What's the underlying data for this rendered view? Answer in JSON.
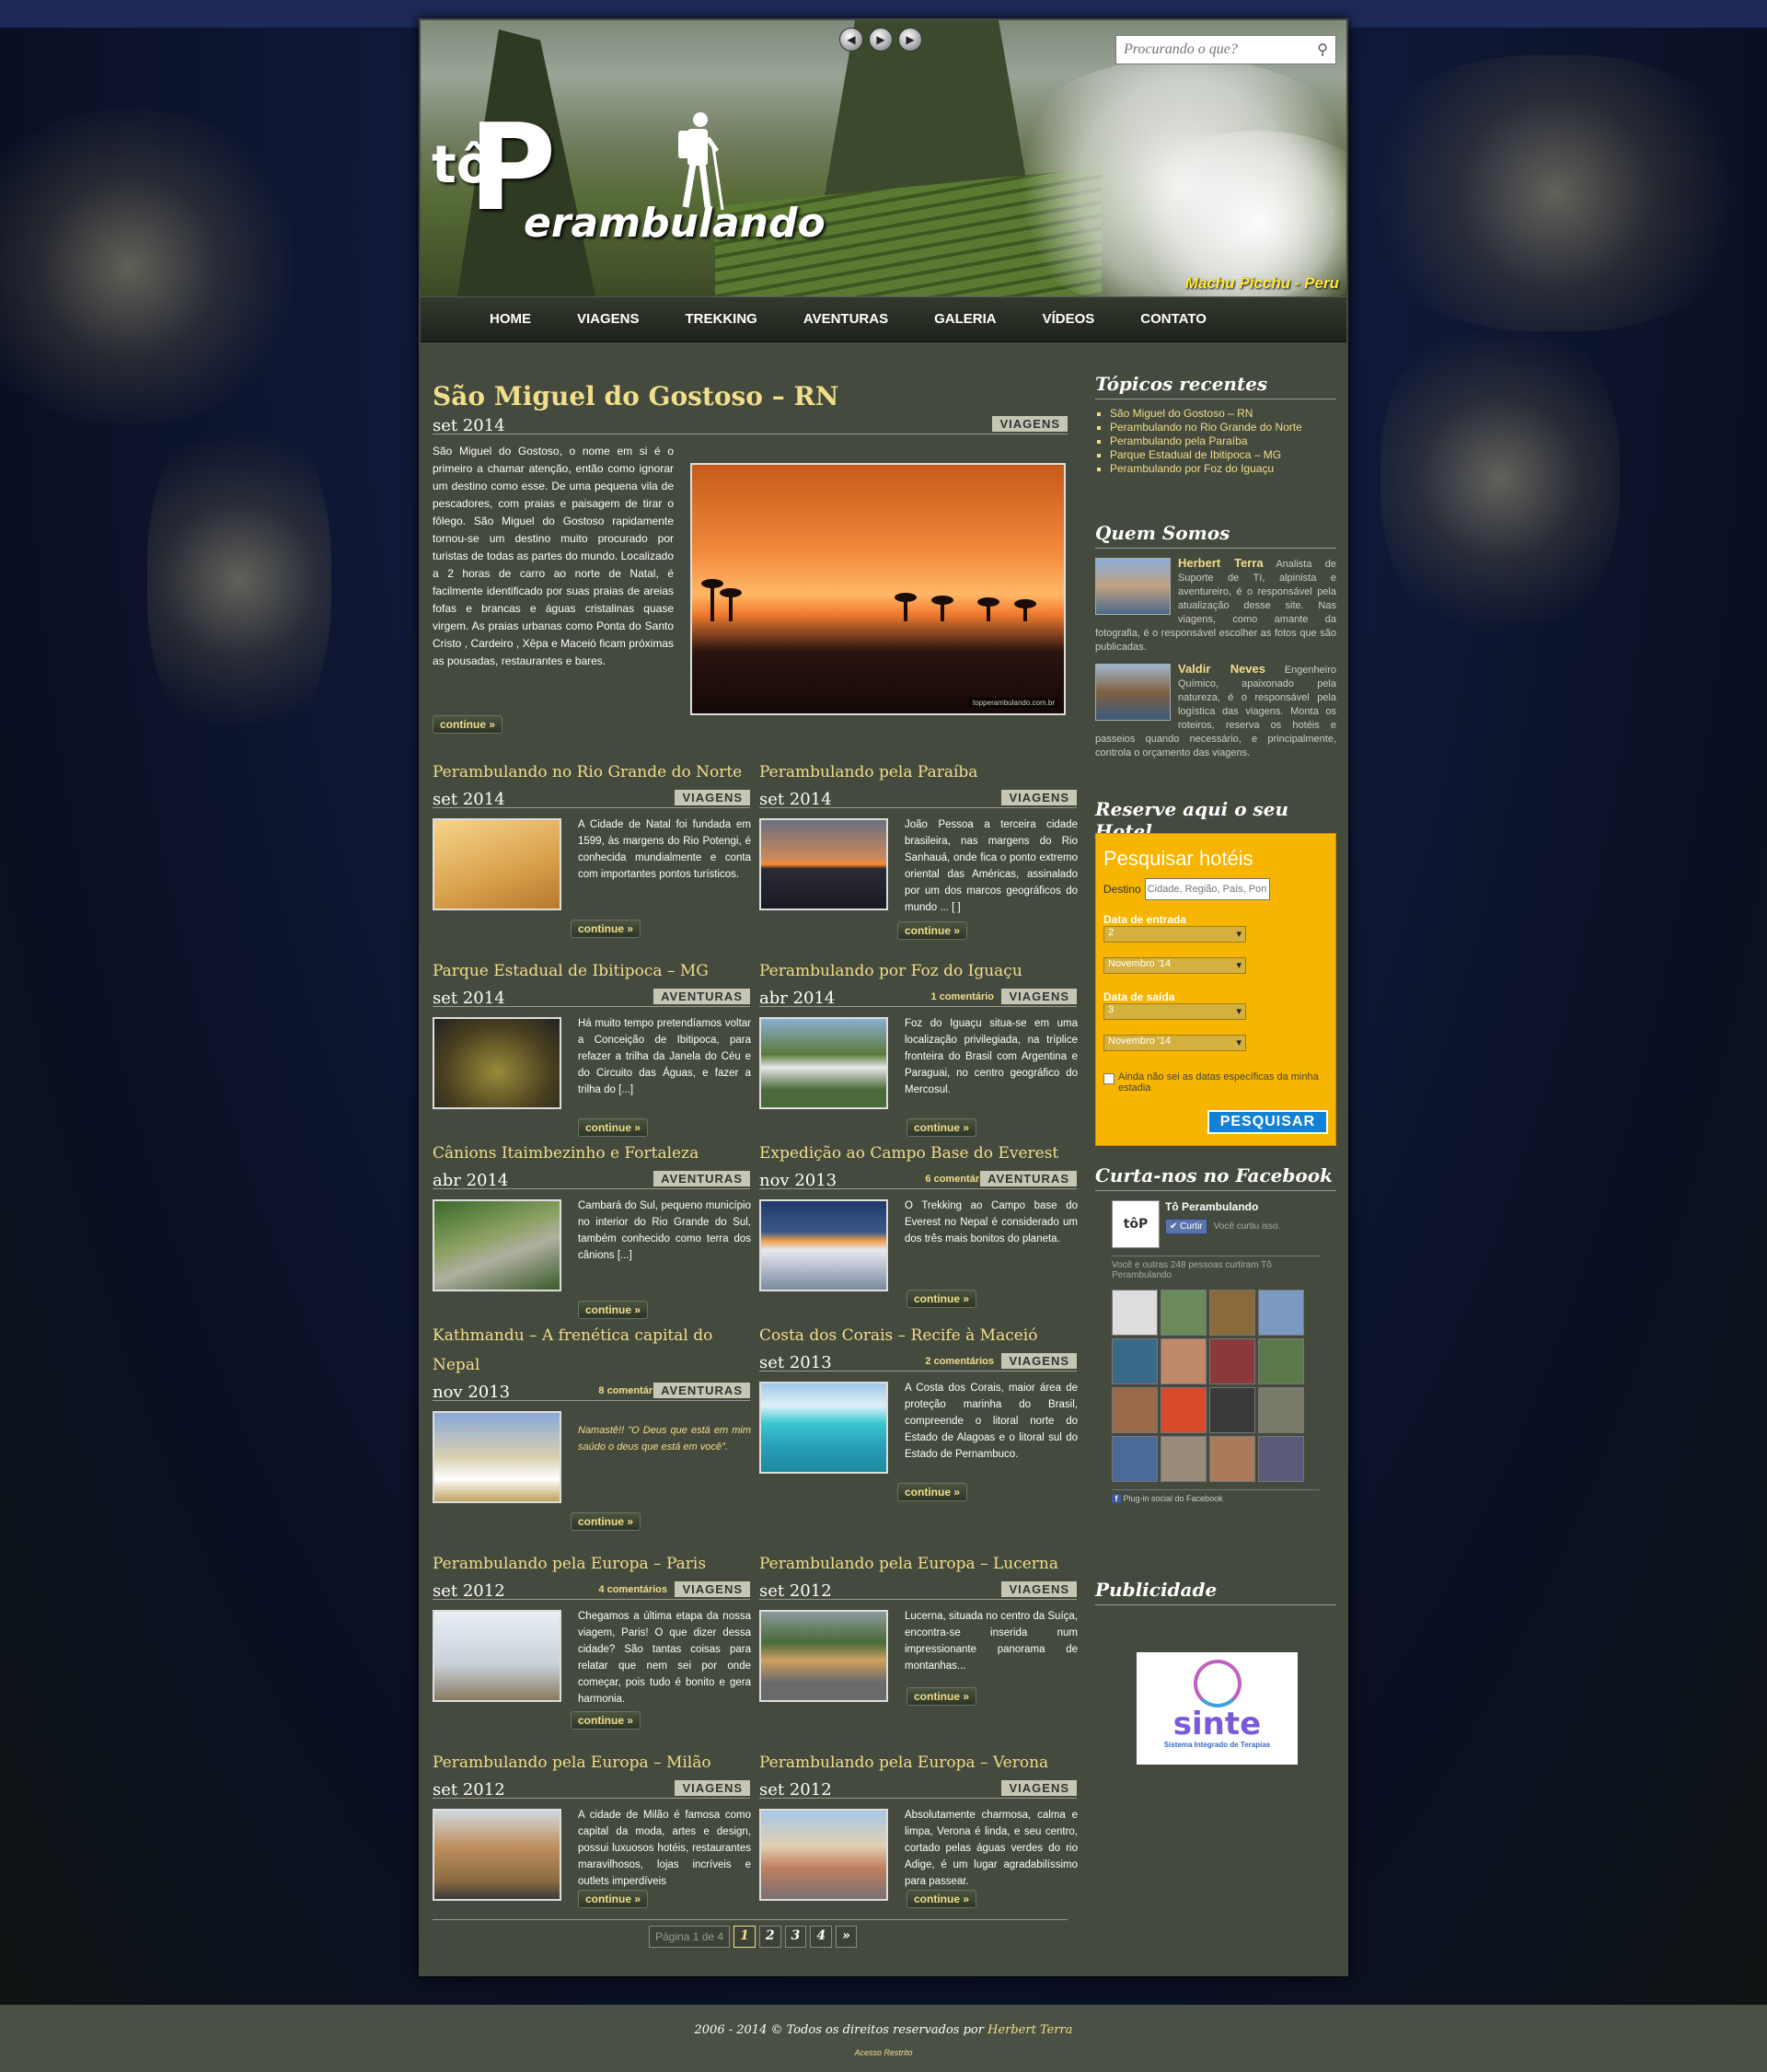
{
  "search": {
    "placeholder": "Procurando o que?"
  },
  "logo": {
    "small": "tô",
    "big": "P",
    "rest": "erambulando"
  },
  "header": {
    "caption": "Machu Picchu - Peru"
  },
  "nav": [
    "HOME",
    "VIAGENS",
    "TREKKING",
    "AVENTURAS",
    "GALERIA",
    "VÍDEOS",
    "CONTATO"
  ],
  "featured": {
    "title": "São Miguel do Gostoso – RN",
    "date": "set 2014",
    "category": "VIAGENS",
    "text": "São Miguel do Gostoso, o nome em si é o primeiro a chamar atenção, então como ignorar um destino como esse. De uma pequena vila de pescadores, com praias e paisagem de tirar o fôlego. São Miguel do Gostoso rapidamente tornou-se um destino muito procurado por turistas de todas as partes do mundo. Localizado a 2 horas de carro ao norte de Natal, é facilmente identificado por suas praias de areias fofas e brancas e águas cristalinas quase virgem. As praias urbanas como Ponta do Santo Cristo , Cardeiro , Xêpa e Maceió ficam próximas as pousadas, restaurantes e bares.",
    "more": "continue »",
    "watermark": "topperambulando.com.br"
  },
  "posts": [
    {
      "title": "Perambulando no Rio Grande do Norte",
      "date": "set 2014",
      "category": "VIAGENS",
      "comments": "",
      "text": "A Cidade de Natal foi fundada em 1599, às margens do Rio Potengi, é conhecida mundialmente e conta com importantes pontos turísticos.",
      "more": "continue »"
    },
    {
      "title": "Perambulando pela Paraíba",
      "date": "set 2014",
      "category": "VIAGENS",
      "comments": "",
      "text": "João Pessoa a terceira cidade brasileira, nas margens do Rio Sanhauá, onde fica o ponto extremo oriental das Américas, assinalado por um dos marcos geográficos do mundo ... [ ]",
      "more": "continue »"
    },
    {
      "title": "Parque Estadual de Ibitipoca – MG",
      "date": "set 2014",
      "category": "AVENTURAS",
      "comments": "",
      "text": "Há muito tempo pretendíamos voltar a Conceição de Ibitipoca, para refazer a trilha da Janela do Céu e do Circuito das Águas, e fazer a trilha do [...]",
      "more": "continue »"
    },
    {
      "title": "Perambulando por Foz do Iguaçu",
      "date": "abr 2014",
      "category": "VIAGENS",
      "comments": "1 comentário",
      "text": "Foz do Iguaçu situa-se em uma localização privilegiada, na tríplice fronteira do Brasil com Argentina e Paraguai, no centro geográfico do Mercosul.",
      "more": "continue »"
    },
    {
      "title": "Cânions Itaimbezinho e Fortaleza",
      "date": "abr 2014",
      "category": "AVENTURAS",
      "comments": "",
      "text": "Cambará do Sul, pequeno município no interior do Rio Grande do Sul, também conhecido como terra dos cânions [...]",
      "more": "continue »"
    },
    {
      "title": "Expedição ao Campo Base do Everest",
      "date": "nov 2013",
      "category": "AVENTURAS",
      "comments": "6 comentários",
      "text": "O Trekking ao Campo base do Everest no Nepal é considerado um dos três mais bonitos do planeta.",
      "more": "continue »"
    },
    {
      "title": "Kathmandu – A frenética capital do Nepal",
      "date": "nov 2013",
      "category": "AVENTURAS",
      "comments": "8 comentários",
      "text": "Namastê!! \"O Deus que está em mim saúdo o deus que está em você\".",
      "more": "continue »"
    },
    {
      "title": "Costa dos Corais – Recife à Maceió",
      "date": "set 2013",
      "category": "VIAGENS",
      "comments": "2 comentários",
      "text": "A Costa dos Corais, maior área de proteção marinha do Brasil, compreende o litoral norte do Estado de Alagoas e o litoral sul do Estado de Pernambuco.",
      "more": "continue »"
    },
    {
      "title": "Perambulando pela Europa – Paris",
      "date": "set 2012",
      "category": "VIAGENS",
      "comments": "4 comentários",
      "text": "Chegamos a última etapa da nossa viagem, Paris! O que dizer dessa cidade? São tantas coisas para relatar que nem sei por onde começar, pois tudo é bonito e gera harmonia.",
      "more": "continue »"
    },
    {
      "title": "Perambulando pela Europa – Lucerna",
      "date": "set 2012",
      "category": "VIAGENS",
      "comments": "",
      "text": "Lucerna, situada no centro da Suíça, encontra-se inserida num impressionante panorama de montanhas...",
      "more": "continue »"
    },
    {
      "title": "Perambulando pela Europa – Milão",
      "date": "set 2012",
      "category": "VIAGENS",
      "comments": "",
      "text": "A cidade de Milão é famosa como capital da moda, artes e design, possui luxuosos hotéis, restaurantes maravilhosos, lojas incríveis e outlets imperdíveis",
      "more": "continue »"
    },
    {
      "title": "Perambulando pela Europa – Verona",
      "date": "set 2012",
      "category": "VIAGENS",
      "comments": "",
      "text": "Absolutamente charmosa, calma e limpa, Verona é linda, e seu centro, cortado pelas águas verdes do rio Adige, é um lugar agradabilíssimo para passear.",
      "more": "continue »"
    }
  ],
  "pagination": {
    "info": "Página 1 de 4",
    "pages": [
      "1",
      "2",
      "3",
      "4",
      "»"
    ]
  },
  "sidebar": {
    "recent_title": "Tópicos recentes",
    "recent": [
      "São Miguel do Gostoso – RN",
      "Perambulando no Rio Grande do Norte",
      "Perambulando pela Paraíba",
      "Parque Estadual de Ibitipoca – MG",
      "Perambulando por Foz do Iguaçu"
    ],
    "about_title": "Quem Somos",
    "people": [
      {
        "name": "Herbert Terra",
        "text": " Analista de Suporte de TI, alpinista e aventureiro, é o responsável pela atualização desse site. Nas viagens, como amante da fotografia, é o responsável escolher as fotos que são publicadas."
      },
      {
        "name": "Valdir Neves",
        "text": " Engenheiro Químico, apaixonado pela natureza, é o responsável pela logística das viagens. Monta os roteiros, reserva os hotéis e passeios quando necessário, e principalmente, controla o orçamento das viagens."
      }
    ],
    "hotel_title": "Reserve aqui o seu Hotel",
    "hotel": {
      "heading": "Pesquisar hotéis",
      "dest_label": "Destino",
      "dest_placeholder": "Cidade, Região, País, Ponto",
      "checkin_label": "Data de entrada",
      "checkin_day": "2",
      "checkin_month": "Novembro '14",
      "checkout_label": "Data de saída",
      "checkout_day": "3",
      "checkout_month": "Novembro '14",
      "checkbox_label": "Ainda não sei as datas específicas da minha estadia",
      "button": "PESQUISAR"
    },
    "fb_title": "Curta-nos no Facebook",
    "fb": {
      "page": "Tô Perambulando",
      "like": "Curtir",
      "you_liked": "Você curtiu isso.",
      "others": "Você e outras 248 pessoas curtiram Tô Perambulando",
      "plugin": "Plug-in social do Facebook"
    },
    "pub_title": "Publicidade",
    "ad": {
      "name": "sinte",
      "tagline": "Sistema Integrado de Terapias"
    }
  },
  "footer": {
    "copyright": "2006 - 2014 © Todos os direitos reservados por ",
    "author": "Herbert Terra",
    "restricted": "Acesso Restrito"
  }
}
